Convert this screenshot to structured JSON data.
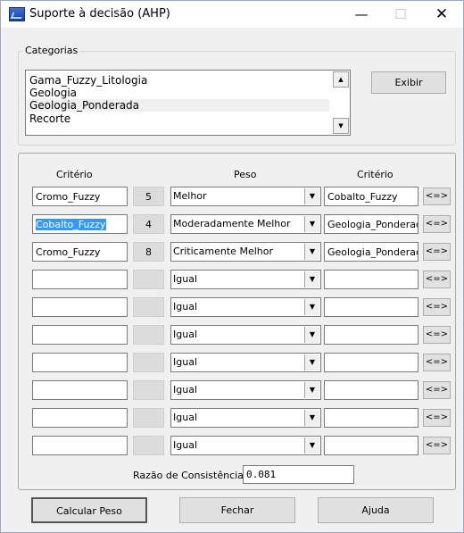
{
  "window": {
    "title": "Suporte à decisão (AHP)",
    "minimize": "—",
    "maximize": "☐",
    "close": "✕"
  },
  "categories": {
    "legend": "Categorias",
    "items": [
      "Gama_Fuzzy_Litologia",
      "Geologia",
      "Geologia_Ponderada",
      "Recorte"
    ],
    "selected_index": 2,
    "show_button": "Exibir"
  },
  "criteria": {
    "header_criterio_left": "Critério",
    "header_peso": "Peso",
    "header_criterio_right": "Critério",
    "swap_label": "<=>",
    "rows": [
      {
        "left": "Cromo_Fuzzy",
        "value": "5",
        "peso": "Melhor",
        "right": "Cobalto_Fuzzy",
        "left_selected": false
      },
      {
        "left": "Cobalto_Fuzzy",
        "value": "4",
        "peso": "Moderadamente Melhor",
        "right": "Geologia_Ponderada",
        "left_selected": true
      },
      {
        "left": "Cromo_Fuzzy",
        "value": "8",
        "peso": "Criticamente Melhor",
        "right": "Geologia_Ponderada",
        "left_selected": false
      },
      {
        "left": "",
        "value": "",
        "peso": "Igual",
        "right": ""
      },
      {
        "left": "",
        "value": "",
        "peso": "Igual",
        "right": ""
      },
      {
        "left": "",
        "value": "",
        "peso": "Igual",
        "right": ""
      },
      {
        "left": "",
        "value": "",
        "peso": "Igual",
        "right": ""
      },
      {
        "left": "",
        "value": "",
        "peso": "Igual",
        "right": ""
      },
      {
        "left": "",
        "value": "",
        "peso": "Igual",
        "right": ""
      },
      {
        "left": "",
        "value": "",
        "peso": "Igual",
        "right": ""
      }
    ],
    "consistency_label": "Razão de Consistência",
    "consistency_value": "0.081"
  },
  "buttons": {
    "calcular": "Calcular Peso",
    "fechar": "Fechar",
    "ajuda": "Ajuda"
  },
  "icons": {
    "app": "ahp-app-icon",
    "dropdown": "dropdown-arrow-icon",
    "scroll_up": "scroll-up-arrow-icon",
    "scroll_down": "scroll-down-arrow-icon"
  }
}
